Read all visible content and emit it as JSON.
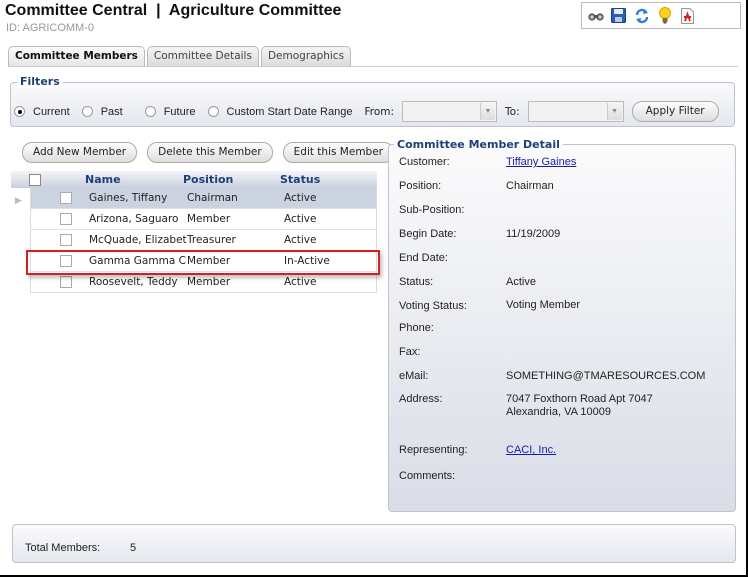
{
  "header": {
    "title": "Committee Central  |  Agriculture Committee",
    "id_label": "ID: AGRICOMM-0"
  },
  "toolbar": {
    "icons": [
      "binoculars-icon",
      "save-icon",
      "refresh-icon",
      "lightbulb-icon",
      "report-icon"
    ]
  },
  "tabs": [
    {
      "label": "Committee Members",
      "active": true
    },
    {
      "label": "Committee Details",
      "active": false
    },
    {
      "label": "Demographics",
      "active": false
    }
  ],
  "filters": {
    "legend": "Filters",
    "options": [
      {
        "label": "Current",
        "selected": true
      },
      {
        "label": "Past",
        "selected": false
      },
      {
        "label": "Future",
        "selected": false
      },
      {
        "label": "Custom Start Date Range",
        "selected": false
      }
    ],
    "from_label": "From:",
    "from_value": "",
    "to_label": "To:",
    "to_value": "",
    "apply_label": "Apply Filter"
  },
  "actions": {
    "add": "Add New Member",
    "delete": "Delete this Member",
    "edit": "Edit this Member"
  },
  "grid": {
    "columns": [
      "Name",
      "Position",
      "Status"
    ],
    "rows": [
      {
        "name": "Gaines, Tiffany",
        "position": "Chairman",
        "status": "Active",
        "selected": true
      },
      {
        "name": "Arizona, Saguaro",
        "position": "Member",
        "status": "Active",
        "selected": false
      },
      {
        "name": "McQuade, Elizabet",
        "position": "Treasurer",
        "status": "Active",
        "selected": false
      },
      {
        "name": "Gamma Gamma C",
        "position": "Member",
        "status": "In-Active",
        "selected": false,
        "highlighted": true
      },
      {
        "name": "Roosevelt, Teddy",
        "position": "Member",
        "status": "Active",
        "selected": false
      }
    ]
  },
  "detail": {
    "legend": "Committee Member Detail",
    "customer_label": "Customer:",
    "customer": "Tiffany Gaines",
    "position_label": "Position:",
    "position": "Chairman",
    "subposition_label": "Sub-Position:",
    "subposition": "",
    "begin_label": "Begin Date:",
    "begin": "11/19/2009",
    "end_label": "End Date:",
    "end": "",
    "status_label": "Status:",
    "status": "Active",
    "voting_label": "Voting Status:",
    "voting": "Voting Member",
    "phone_label": "Phone:",
    "phone": "",
    "fax_label": "Fax:",
    "fax": "",
    "email_label": "eMail:",
    "email": "SOMETHING@TMARESOURCES.COM",
    "address_label": "Address:",
    "address_line1": "7047 Foxthorn Road Apt 7047",
    "address_line2": "Alexandria, VA 10009",
    "representing_label": "Representing:",
    "representing": "CACI, Inc.",
    "comments_label": "Comments:",
    "comments": ""
  },
  "footer": {
    "total_label": "Total Members:",
    "total_value": "5"
  },
  "colors": {
    "accent": "#1f3f78",
    "selected_row": "#cbd3e1",
    "highlight_box": "#d42020",
    "link": "#1a1aa6"
  }
}
